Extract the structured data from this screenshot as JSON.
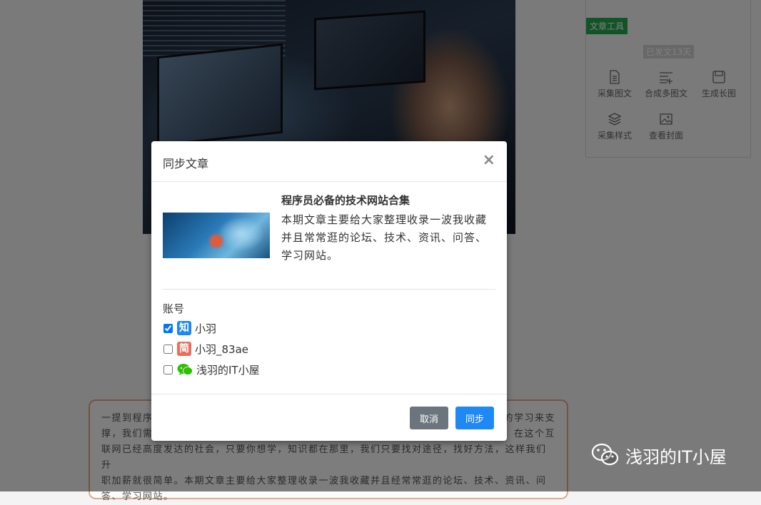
{
  "tools": {
    "tag": "文章工具",
    "days": "已发文13天",
    "items": [
      {
        "label": "采集图文",
        "icon": "document-icon"
      },
      {
        "label": "合成多图文",
        "icon": "list-add-icon"
      },
      {
        "label": "生成长图",
        "icon": "save-icon"
      },
      {
        "label": "采集样式",
        "icon": "layers-icon"
      },
      {
        "label": "查看封面",
        "icon": "image-icon"
      }
    ]
  },
  "article_body": {
    "line1a": "一提到程序",
    "line1b": "的学习来支",
    "line2a": "撑，我们需",
    "line2b": "，在这个互",
    "line3": "联网已经高度发达的社会，只要你想学，知识都在那里，我们只要找对途径，找好方法，这样我们升",
    "line4": "职加薪就很简单。本期文章主要给大家整理收录一波我收藏并且经常常逛的论坛、技术、资讯、问",
    "line5": "答、学习网站。"
  },
  "watermark": "浅羽的IT小屋",
  "modal": {
    "title": "同步文章",
    "close": "×",
    "article": {
      "title": "程序员必备的技术网站合集",
      "description": "本期文章主要给大家整理收录一波我收藏并且常常逛的论坛、技术、资讯、问答、学习网站。"
    },
    "accounts_label": "账号",
    "accounts": [
      {
        "badge": "知",
        "name": "小羽",
        "checked": true,
        "color": "#1e88f5"
      },
      {
        "badge": "简",
        "name": "小羽_83ae",
        "checked": false,
        "color": "#ea6f5a"
      },
      {
        "badge": "",
        "name": "浅羽的IT小屋",
        "checked": false,
        "color": "#2dc100"
      }
    ],
    "cancel_label": "取消",
    "sync_label": "同步"
  }
}
